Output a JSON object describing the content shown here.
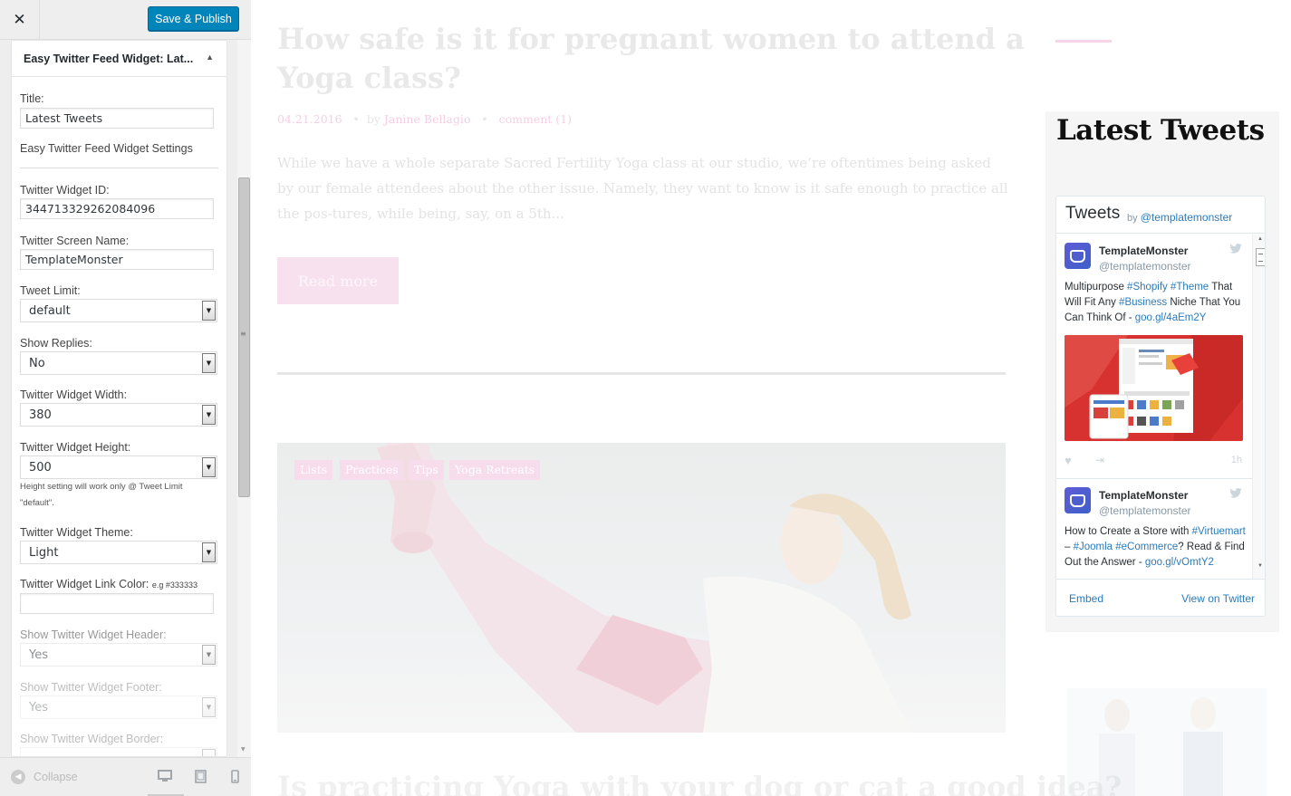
{
  "customizer": {
    "close_icon": "close-icon",
    "publish_label": "Save & Publish",
    "widget_title": "Easy Twitter Feed Widget: Lat...",
    "fields": {
      "title_label": "Title:",
      "title_value": "Latest Tweets",
      "settings_heading": "Easy Twitter Feed Widget Settings",
      "widget_id_label": "Twitter Widget ID:",
      "widget_id_value": "344713329262084096",
      "screen_name_label": "Twitter Screen Name:",
      "screen_name_value": "TemplateMonster",
      "tweet_limit_label": "Tweet Limit:",
      "tweet_limit_value": "default",
      "show_replies_label": "Show Replies:",
      "show_replies_value": "No",
      "width_label": "Twitter Widget Width:",
      "width_value": "380",
      "height_label": "Twitter Widget Height:",
      "height_value": "500",
      "height_note": "Height setting will work only @ Tweet Limit \"default\".",
      "theme_label": "Twitter Widget Theme:",
      "theme_value": "Light",
      "link_color_label": "Twitter Widget Link Color:",
      "link_color_hint": "e.g #333333",
      "link_color_value": "",
      "show_header_label": "Show Twitter Widget Header:",
      "show_header_value": "Yes",
      "show_footer_label": "Show Twitter Widget Footer:",
      "show_footer_value": "Yes",
      "show_border_label": "Show Twitter Widget Border:"
    },
    "footer": {
      "collapse_label": "Collapse",
      "devices": [
        "desktop-icon",
        "tablet-icon",
        "mobile-icon"
      ]
    }
  },
  "preview": {
    "post_title": "How safe is it for pregnant women to attend a Yoga class?",
    "post_date": "04.21.2016",
    "by_label": "by",
    "author": "Janine Bellagio",
    "comments": "comment (1)",
    "excerpt": "While we have a whole separate Sacred Fertility Yoga class at our studio, we’re oftentimes being asked by our female attendees about the other issue. Namely, they want to know is it safe enough to practice all the pos-tures, while being, say, on a 5th...",
    "read_more": "Read more",
    "tags": [
      "Lists",
      "Practices",
      "Tips",
      "Yoga Retreats"
    ],
    "next_post_title": "Is practicing Yoga with your dog or cat a good idea?"
  },
  "widget": {
    "title": "Latest Tweets",
    "timeline": {
      "header_title": "Tweets",
      "by": "by",
      "handle": "@templatemonster",
      "tweets": [
        {
          "name": "TemplateMonster",
          "handle": "@templatemonster",
          "text_parts": [
            "Multipurpose ",
            "#Shopify",
            " ",
            "#Theme",
            " That Will Fit Any ",
            "#Business",
            " Niche That You Can Think Of - ",
            "goo.gl/4aEm2Y"
          ],
          "time": "1h"
        },
        {
          "name": "TemplateMonster",
          "handle": "@templatemonster",
          "text_parts": [
            "How to Create a Store with ",
            "#Virtuemart",
            " – ",
            "#Joomla",
            " ",
            "#eCommerce",
            "? Read & Find Out the Answer - ",
            "goo.gl/vOmtY2"
          ]
        }
      ],
      "embed": "Embed",
      "view_on_twitter": "View on Twitter"
    }
  },
  "colors": {
    "publish_blue": "#0085ba",
    "twitter_link": "#2b7bb9",
    "accent_pink": "#f4cfe3"
  }
}
